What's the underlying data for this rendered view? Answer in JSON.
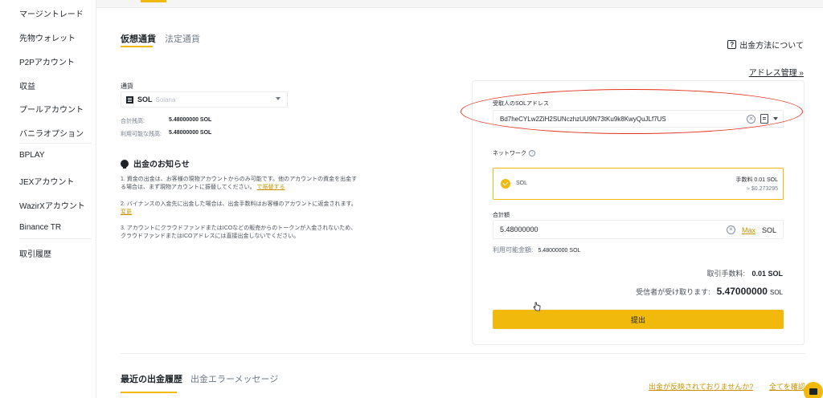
{
  "sidebar": {
    "items": [
      {
        "label": "マージントレード"
      },
      {
        "label": "先物ウォレット"
      },
      {
        "label": "P2Pアカウント"
      },
      {
        "label": "収益"
      },
      {
        "label": "プールアカウント"
      },
      {
        "label": "バニラオプション"
      },
      {
        "label": "BPLAY"
      },
      {
        "label": "JEXアカウント"
      },
      {
        "label": "WazirXアカウント"
      },
      {
        "label": "Binance TR"
      },
      {
        "label": "取引履歴"
      }
    ]
  },
  "tabs": {
    "crypto": "仮想通貨",
    "fiat": "法定通貨"
  },
  "header": {
    "how_to_withdraw": "出金方法について",
    "address_management": "アドレス管理 »"
  },
  "coin": {
    "label": "通貨",
    "symbol": "SOL",
    "name": "Solana",
    "total_label": "合計残高:",
    "total_value": "5.48000000 SOL",
    "available_label": "利用可能な残高:",
    "available_value": "5.48000000 SOL"
  },
  "notice": {
    "title": "出金のお知らせ",
    "p1": "1. 資金の出金は、お客様の現物アカウントからのみ可能です。他のアカウントの資金を出金する場合は、まず現物アカウントに振替してください。",
    "p1_link": "で振替する",
    "p2": "2. バイナンスの入金先に出金した場合は、出金手数料はお客様のアカウントに返金されます。",
    "p2_link": "変更",
    "p3": "3. アカウントにクラウドファンドまたはICOなどの販売からのトークンが入金されないため、クラウドファンドまたはICOアドレスには直接出金しないでください。"
  },
  "form": {
    "address_label": "受取人のSOLアドレス",
    "address_value": "Bd7heCYLw2ZiH2SUNczhzUU9N73tKu9k8KwyQuJLf7US",
    "network_label": "ネットワーク",
    "network_name": "SOL",
    "network_fee": "手数料 0.01 SOL",
    "network_fee_usd": "≈ $0.273295",
    "amount_label": "合計額",
    "amount_value": "5.48000000",
    "max_label": "Max",
    "amount_unit": "SOL",
    "avail_label": "利用可能金額:",
    "avail_value": "5.48000000 SOL",
    "fee_label": "取引手数料:",
    "fee_value": "0.01 SOL",
    "receive_label": "受信者が受け取ります:",
    "receive_value": "5.47000000",
    "receive_unit": "SOL",
    "submit_label": "提出"
  },
  "bottom": {
    "tab_recent": "最近の出金履歴",
    "tab_errors": "出金エラーメッセージ",
    "link_not_reflected": "出金が反映されておりませんか?",
    "link_view_all": "全てを確認"
  },
  "colors": {
    "accent": "#f0b90b",
    "annotation_circle": "#e5301d"
  }
}
